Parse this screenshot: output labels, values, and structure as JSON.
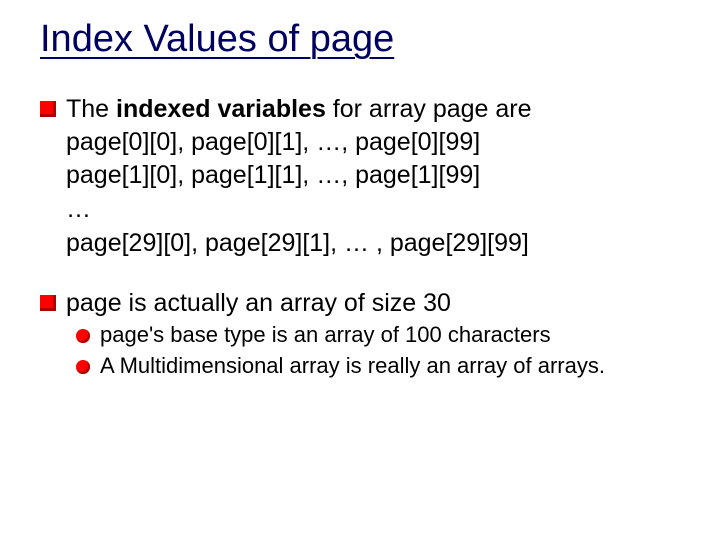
{
  "title": "Index Values of page",
  "b1": {
    "pre": "The ",
    "bold": "indexed variables",
    "post": " for array page are"
  },
  "lines": {
    "l1": "page[0][0], page[0][1], …, page[0][99]",
    "l2": "page[1][0], page[1][1], …, page[1][99]",
    "l3": "…",
    "l4": "page[29][0], page[29][1], … , page[29][99]"
  },
  "b2": "page is actually an array of size 30",
  "sub": {
    "s1": "page's base type is an array of 100 characters",
    "s2": "A Multidimensional array is really an array of arrays."
  }
}
